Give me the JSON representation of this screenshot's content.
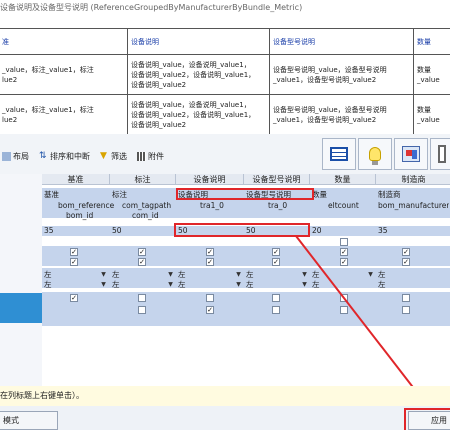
{
  "preview": {
    "title": "设备说明及设备型号说明 (ReferenceGroupedByManufacturerByBundle_Metric)",
    "headers": [
      "准",
      "设备说明",
      "设备型号说明",
      "数量"
    ],
    "rows": [
      [
        "_value，标注_value1，标注\nlue2",
        "设备说明_value，设备说明_value1，\n设备说明_value2，设备说明_value1，\n设备说明_value2",
        "设备型号说明_value，设备型号说明\n_value1，设备型号说明_value2",
        "数量_value"
      ],
      [
        "_value，标注_value1，标注\nlue2",
        "设备说明_value，设备说明_value1，\n设备说明_value2，设备说明_value1，\n设备说明_value2",
        "设备型号说明_value，设备型号说明\n_value1，设备型号说明_value2",
        "数量_value"
      ]
    ]
  },
  "toolbar": {
    "layout_label": "布局",
    "sort_label": "排序和中断",
    "filter_label": "筛选",
    "attach_label": "附件"
  },
  "grid": {
    "columns": [
      "基准",
      "标注",
      "设备说明",
      "设备型号说明",
      "数量",
      "制造商"
    ],
    "headings_row": [
      "基准",
      "标注",
      "设备说明",
      "设备型号说明",
      "数量",
      "制造商"
    ],
    "fields_row": [
      "bom_reference",
      "com_tagpath",
      "tra1_0",
      "tra_0",
      "eltcount",
      "bom_manufacturer"
    ],
    "fields_row2": [
      "bom_id",
      "com_id",
      "",
      "",
      "",
      ""
    ],
    "widths_row": [
      "35",
      "50",
      "50",
      "50",
      "20",
      "35"
    ],
    "align_label": "左"
  },
  "hint": "在列标题上右键单击）。",
  "bottom": {
    "mode_label": "模式",
    "apply_label": "应用"
  }
}
